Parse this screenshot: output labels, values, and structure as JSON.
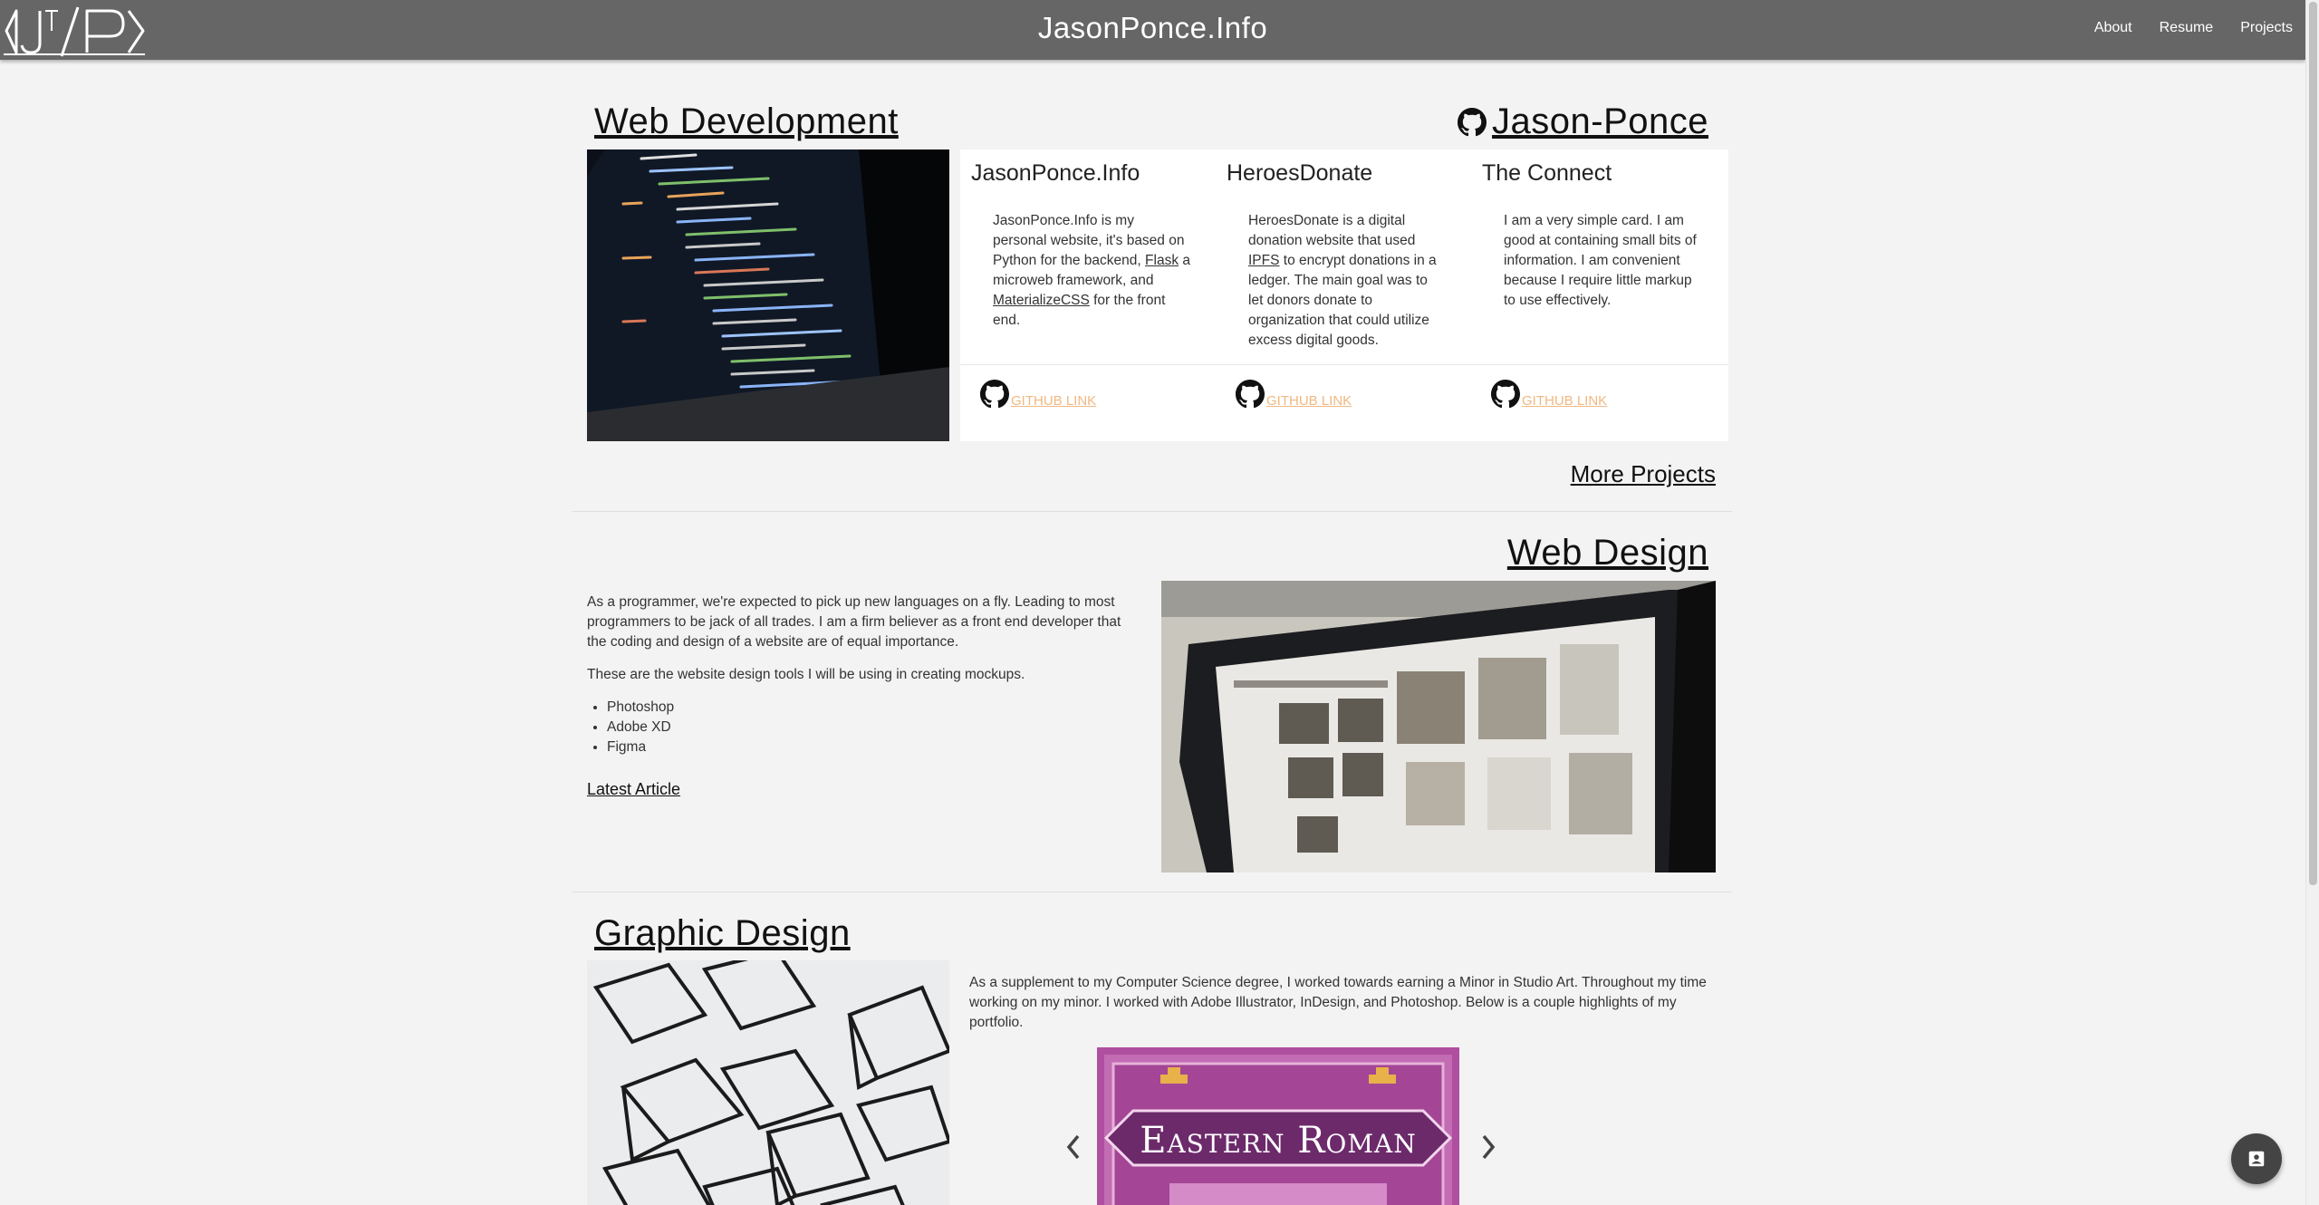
{
  "nav": {
    "title": "JasonPonce.Info",
    "logo_text": "J/P",
    "links": [
      "About",
      "Resume",
      "Projects"
    ]
  },
  "web_development": {
    "heading": "Web Development",
    "github_heading": "Jason-Ponce",
    "cards": [
      {
        "title": "JasonPonce.Info",
        "body_parts": [
          "JasonPonce.Info is my personal website, it's based on Python for the backend, ",
          "Flask",
          " a microweb framework, and ",
          "MaterializeCSS",
          " for the front end."
        ],
        "link_label": "GITHUB LINK"
      },
      {
        "title": "HeroesDonate",
        "body_parts": [
          "HeroesDonate is a digital donation website that used ",
          "IPFS",
          " to encrypt donations in a ledger. The main goal was to let donors donate to organization that could utilize excess digital goods."
        ],
        "link_label": "GITHUB LINK"
      },
      {
        "title": "The Connect",
        "body_parts": [
          "I am a very simple card. I am good at containing small bits of information. I am convenient because I require little markup to use effectively."
        ],
        "link_label": "GITHUB LINK"
      }
    ],
    "more_projects": "More Projects"
  },
  "web_design": {
    "heading": "Web Design",
    "paragraph1": "As a programmer, we're expected to pick up new languages on a fly. Leading to most programmers to be jack of all trades. I am a firm believer as a front end developer that the coding and design of a website are of equal importance.",
    "paragraph2": "These are the website design tools I will be using in creating mockups.",
    "tools": [
      "Photoshop",
      "Adobe XD",
      "Figma"
    ],
    "latest_article": "Latest Article"
  },
  "graphic_design": {
    "heading": "Graphic Design",
    "paragraph": "As a supplement to my Computer Science degree, I worked towards earning a Minor in Studio Art. Throughout my time working on my minor. I worked with Adobe Illustrator, InDesign, and Photoshop. Below is a couple highlights of my portfolio.",
    "poster_text": "Eastern Roman"
  },
  "colors": {
    "navbar": "#666666",
    "background": "#f3f3f3",
    "link_accent": "#f0b882",
    "poster_purple": "#b04ea0"
  },
  "icons": [
    "github-icon",
    "chevron-left-icon",
    "chevron-right-icon",
    "contact-card-icon"
  ]
}
